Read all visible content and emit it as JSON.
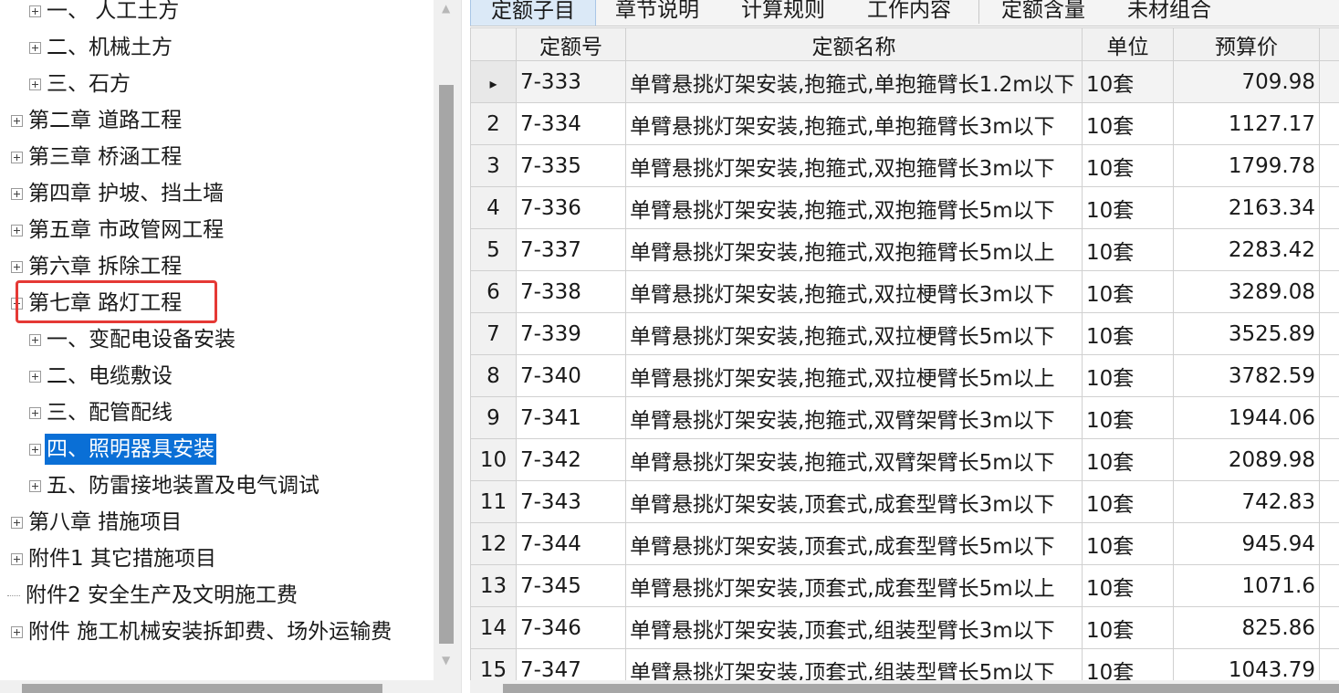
{
  "tree": {
    "items": [
      {
        "label": "一、 人工土方",
        "level": 2,
        "expander": "plus"
      },
      {
        "label": "二、机械土方",
        "level": 2,
        "expander": "plus"
      },
      {
        "label": "三、石方",
        "level": 2,
        "expander": "plus"
      },
      {
        "label": "第二章 道路工程",
        "level": 1,
        "expander": "plus"
      },
      {
        "label": "第三章 桥涵工程",
        "level": 1,
        "expander": "plus"
      },
      {
        "label": "第四章 护坡、挡土墙",
        "level": 1,
        "expander": "plus"
      },
      {
        "label": "第五章 市政管网工程",
        "level": 1,
        "expander": "plus"
      },
      {
        "label": "第六章 拆除工程",
        "level": 1,
        "expander": "plus"
      },
      {
        "label": "第七章 路灯工程",
        "level": 1,
        "expander": "minus",
        "highlighted": true
      },
      {
        "label": "一、变配电设备安装",
        "level": 2,
        "expander": "plus"
      },
      {
        "label": "二、电缆敷设",
        "level": 2,
        "expander": "plus"
      },
      {
        "label": "三、配管配线",
        "level": 2,
        "expander": "plus"
      },
      {
        "label": "四、照明器具安装",
        "level": 2,
        "expander": "plus",
        "selected": true
      },
      {
        "label": "五、防雷接地装置及电气调试",
        "level": 2,
        "expander": "plus"
      },
      {
        "label": "第八章 措施项目",
        "level": 1,
        "expander": "plus"
      },
      {
        "label": "附件1 其它措施项目",
        "level": 1,
        "expander": "plus"
      },
      {
        "label": "附件2 安全生产及文明施工费",
        "level": 1,
        "expander": "none"
      },
      {
        "label": "附件 施工机械安装拆卸费、场外运输费",
        "level": 1,
        "expander": "plus"
      }
    ]
  },
  "tabs": [
    {
      "label": "定额子目",
      "active": true
    },
    {
      "label": "章节说明",
      "active": false
    },
    {
      "label": "计算规则",
      "active": false
    },
    {
      "label": "工作内容",
      "active": false
    },
    {
      "label": "定额含量",
      "active": false
    },
    {
      "label": "未材组合",
      "active": false
    }
  ],
  "table": {
    "columns": [
      "",
      "定额号",
      "定额名称",
      "单位",
      "预算价"
    ],
    "current_marker": "▸",
    "rows": [
      {
        "num": "1",
        "code": "7-333",
        "name": "单臂悬挑灯架安装,抱箍式,单抱箍臂长1.2m以下",
        "unit": "10套",
        "price": "709.98"
      },
      {
        "num": "2",
        "code": "7-334",
        "name": "单臂悬挑灯架安装,抱箍式,单抱箍臂长3m以下",
        "unit": "10套",
        "price": "1127.17"
      },
      {
        "num": "3",
        "code": "7-335",
        "name": "单臂悬挑灯架安装,抱箍式,双抱箍臂长3m以下",
        "unit": "10套",
        "price": "1799.78"
      },
      {
        "num": "4",
        "code": "7-336",
        "name": "单臂悬挑灯架安装,抱箍式,双抱箍臂长5m以下",
        "unit": "10套",
        "price": "2163.34"
      },
      {
        "num": "5",
        "code": "7-337",
        "name": "单臂悬挑灯架安装,抱箍式,双抱箍臂长5m以上",
        "unit": "10套",
        "price": "2283.42"
      },
      {
        "num": "6",
        "code": "7-338",
        "name": "单臂悬挑灯架安装,抱箍式,双拉梗臂长3m以下",
        "unit": "10套",
        "price": "3289.08"
      },
      {
        "num": "7",
        "code": "7-339",
        "name": "单臂悬挑灯架安装,抱箍式,双拉梗臂长5m以下",
        "unit": "10套",
        "price": "3525.89"
      },
      {
        "num": "8",
        "code": "7-340",
        "name": "单臂悬挑灯架安装,抱箍式,双拉梗臂长5m以上",
        "unit": "10套",
        "price": "3782.59"
      },
      {
        "num": "9",
        "code": "7-341",
        "name": "单臂悬挑灯架安装,抱箍式,双臂架臂长3m以下",
        "unit": "10套",
        "price": "1944.06"
      },
      {
        "num": "10",
        "code": "7-342",
        "name": "单臂悬挑灯架安装,抱箍式,双臂架臂长5m以下",
        "unit": "10套",
        "price": "2089.98"
      },
      {
        "num": "11",
        "code": "7-343",
        "name": "单臂悬挑灯架安装,顶套式,成套型臂长3m以下",
        "unit": "10套",
        "price": "742.83"
      },
      {
        "num": "12",
        "code": "7-344",
        "name": "单臂悬挑灯架安装,顶套式,成套型臂长5m以下",
        "unit": "10套",
        "price": "945.94"
      },
      {
        "num": "13",
        "code": "7-345",
        "name": "单臂悬挑灯架安装,顶套式,成套型臂长5m以上",
        "unit": "10套",
        "price": "1071.6"
      },
      {
        "num": "14",
        "code": "7-346",
        "name": "单臂悬挑灯架安装,顶套式,组装型臂长3m以下",
        "unit": "10套",
        "price": "825.86"
      },
      {
        "num": "15",
        "code": "7-347",
        "name": "单臂悬挑灯架安装,顶套式,组装型臂长5m以下",
        "unit": "10套",
        "price": "1043.79"
      }
    ]
  },
  "colors": {
    "selection": "#0a6fd6",
    "highlight_box": "#e53935",
    "active_tab": "#dbe9f7"
  }
}
